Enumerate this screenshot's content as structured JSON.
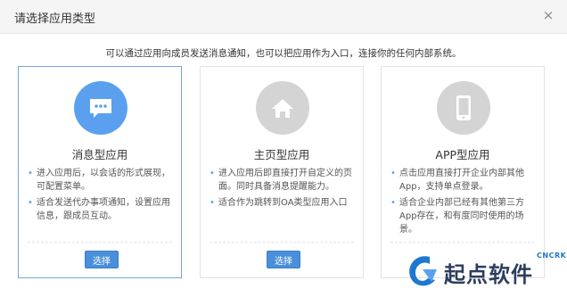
{
  "dialog": {
    "title": "请选择应用类型",
    "close_label": "×",
    "subtitle": "可以通过应用向成员发送消息通知，也可以把应用作为入口，连接你的任何内部系统。"
  },
  "cards": [
    {
      "title": "消息型应用",
      "icon": "chat-bubble-icon",
      "bullets": [
        "进入应用后，以会话的形式展现，可配置菜单。",
        "适合发送代办事项通知，设置应用信息，跟成员互动。"
      ],
      "button": "选择",
      "selected": true
    },
    {
      "title": "主页型应用",
      "icon": "home-icon",
      "bullets": [
        "进入应用后即直接打开自定义的页面。同时具备消息提醒能力。",
        "适合作为跳转到OA类型应用入口"
      ],
      "button": "选择",
      "selected": false
    },
    {
      "title": "APP型应用",
      "icon": "mobile-phone-icon",
      "bullets": [
        "点击应用直接打开企业内部其他App，支持单点登录。",
        "适合企业内部已经有其他第三方App存在，和有度同时使用的场景。"
      ],
      "button": "",
      "selected": false
    }
  ],
  "watermark": {
    "text": "起点软件",
    "sub": "CNCRK"
  },
  "colors": {
    "accent": "#5aa0ef",
    "button": "#4a8fd9",
    "icon_inactive": "#d4d4d4"
  }
}
